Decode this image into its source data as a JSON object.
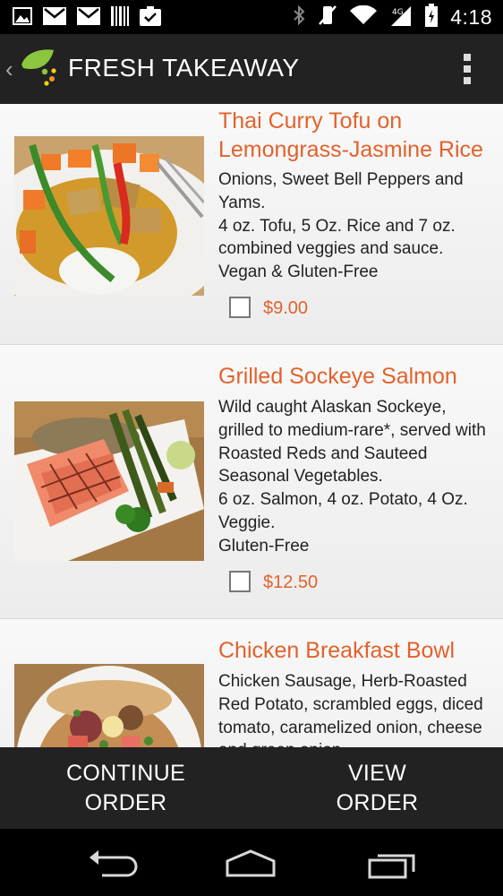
{
  "status_bar": {
    "time": "4:18",
    "left_icons": [
      "gallery-icon",
      "gmail-icon",
      "gmail-icon",
      "barcode-icon",
      "clipboard-check-icon"
    ],
    "right_icons": [
      "bluetooth-icon",
      "vibrate-icon",
      "wifi-icon",
      "signal-icon",
      "battery-icon"
    ]
  },
  "action_bar": {
    "title": "FRESH TAKEAWAY",
    "logo": "leaf-logo",
    "accent": "#8cc63f"
  },
  "menu_items": [
    {
      "title": "Thai Curry Tofu on Lemongrass-Jasmine Rice",
      "description": "Onions, Sweet Bell Peppers and Yams.\n4 oz. Tofu, 5 Oz. Rice and 7 oz. combined veggies and sauce.\nVegan & Gluten-Free",
      "price": "$9.00",
      "selected": false
    },
    {
      "title": "Grilled Sockeye Salmon",
      "description": "Wild caught Alaskan Sockeye, grilled to medium-rare*, served with Roasted Reds and Sauteed Seasonal Vegetables.\n6 oz. Salmon, 4 oz. Potato, 4 Oz. Veggie.\nGluten-Free",
      "price": "$12.50",
      "selected": false
    },
    {
      "title": "Chicken Breakfast Bowl",
      "description": "Chicken Sausage, Herb-Roasted Red Potato, scrambled eggs, diced tomato, caramelized onion, cheese and green onion",
      "price": "",
      "selected": false
    }
  ],
  "bottom_bar": {
    "continue_label": "CONTINUE\nORDER",
    "view_label": "VIEW\nORDER"
  },
  "colors": {
    "title_orange": "#e2622c",
    "bar_dark": "#222222"
  }
}
